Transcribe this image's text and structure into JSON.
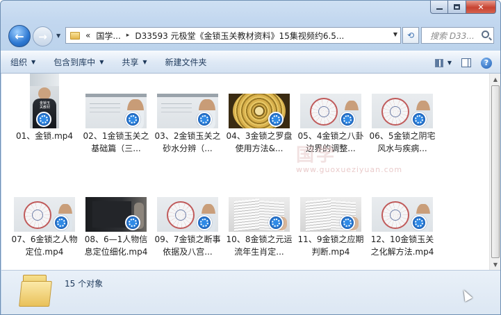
{
  "window": {
    "caption_buttons": {
      "minimize": "minimize-icon",
      "maximize": "maximize-icon",
      "close": "close-icon"
    }
  },
  "address_bar": {
    "overflow": "«",
    "crumbs": [
      "国学...",
      "D33593 元极堂《金锁玉关教材资料》15集视频约6.5..."
    ],
    "separator": "▸"
  },
  "search": {
    "placeholder": "搜索 D33..."
  },
  "toolbar": {
    "organize": "组织",
    "include_in_library": "包含到库中",
    "share": "共享",
    "new_folder": "新建文件夹"
  },
  "files": [
    {
      "name": "01、金锁.mp4",
      "thumb": "portrait"
    },
    {
      "name": "02、1金锁玉关之基础篇（三...",
      "thumb": "whiteboard"
    },
    {
      "name": "03、2金锁玉关之砂水分辨（...",
      "thumb": "whiteboard"
    },
    {
      "name": "04、3金锁之罗盘使用方法&...",
      "thumb": "compass"
    },
    {
      "name": "05、4金锁之八卦边界的调整...",
      "thumb": "diagram"
    },
    {
      "name": "06、5金锁之阴宅风水与疾病...",
      "thumb": "diagram"
    },
    {
      "name": "07、6金锁之人物定位.mp4",
      "thumb": "diagram"
    },
    {
      "name": "08、6—1人物信息定位细化.mp4",
      "thumb": "dark"
    },
    {
      "name": "09、7金锁之断事依据及八宫...",
      "thumb": "diagram"
    },
    {
      "name": "10、8金锁之元运流年生肖定...",
      "thumb": "book"
    },
    {
      "name": "11、9金锁之应期判断.mp4",
      "thumb": "book"
    },
    {
      "name": "12、10金锁玉关之化解方法.mp4",
      "thumb": "diagram"
    }
  ],
  "portrait_text": [
    "金锁玉",
    "关教材"
  ],
  "watermark": {
    "main": "国学",
    "url": "www.guoxueziyuan.com"
  },
  "status": {
    "count": "15 个对象"
  },
  "colors": {
    "accent": "#1d5fb3",
    "toolbar_text": "#1e395b"
  }
}
